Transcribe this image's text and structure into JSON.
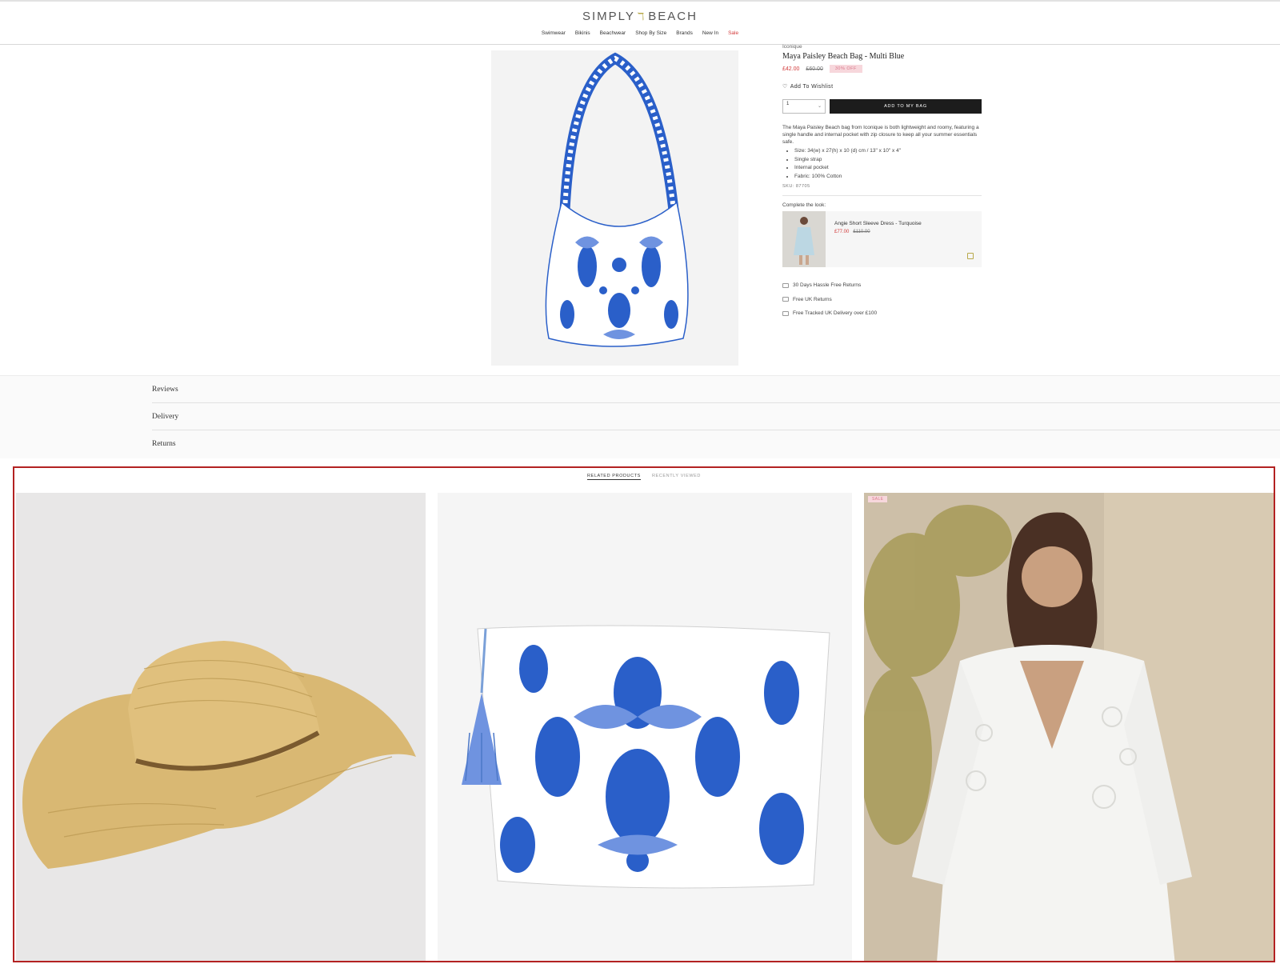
{
  "header": {
    "logo_left": "SIMPLY",
    "logo_right": "BEACH",
    "nav": [
      "Swimwear",
      "Bikinis",
      "Beachwear",
      "Shop By Size",
      "Brands",
      "New In",
      "Sale"
    ]
  },
  "product": {
    "brand": "Iconique",
    "title": "Maya Paisley Beach Bag - Multi Blue",
    "price_now": "£42.00",
    "price_was": "£60.00",
    "discount_badge": "30% OFF",
    "wishlist_label": "Add To Wishlist",
    "quantity_value": "1",
    "add_to_bag_label": "ADD TO MY BAG",
    "description": "The Maya Paisley Beach bag from Iconique is both lightweight and roomy, featuring a single handle and internal pocket with zip closure to keep all your summer essentials safe.",
    "bullets": [
      "Size:  34(w) x 27(h) x 10 (d) cm / 13\" x 10\" x 4\"",
      "Single strap",
      "Internal pocket",
      "Fabric: 100% Cotton"
    ],
    "sku": "SKU: 87705"
  },
  "complete_look": {
    "title": "Complete the look:",
    "item_name": "Angie Short Sleeve Dress - Turquoise",
    "price_now": "£77.00",
    "price_was": "£110.00"
  },
  "perks": [
    "30 Days Hassle Free Returns",
    "Free UK Returns",
    "Free Tracked UK Delivery over £100"
  ],
  "accordion": [
    "Reviews",
    "Delivery",
    "Returns"
  ],
  "related": {
    "tabs": [
      "RELATED PRODUCTS",
      "RECENTLY VIEWED"
    ],
    "sale_badge": "SALE"
  },
  "colors": {
    "accent_red": "#d23b3b",
    "badge_pink": "#f7d7dc",
    "highlight_border": "#b32222",
    "button_dark": "#1c1c1c",
    "pattern_blue": "#2a5fc9"
  }
}
